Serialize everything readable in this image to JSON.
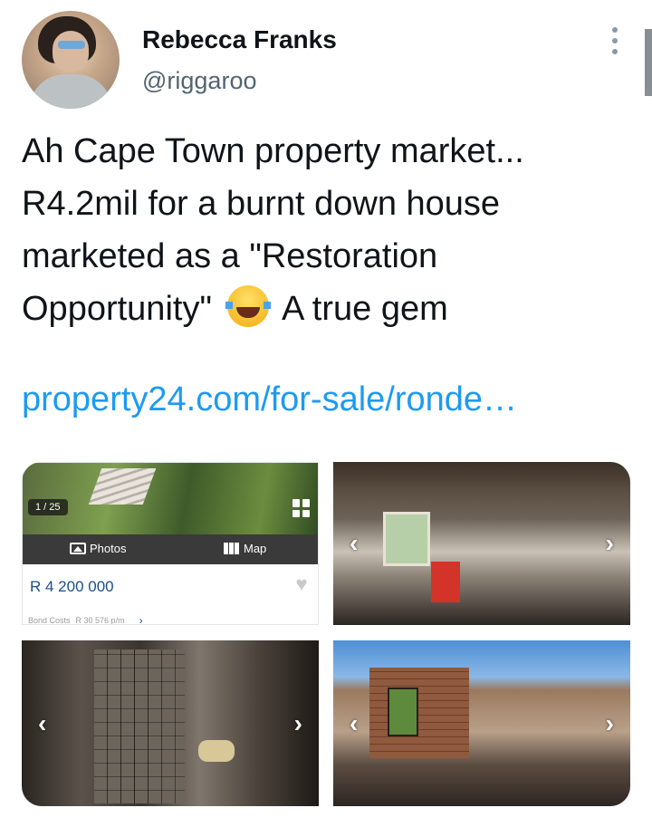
{
  "author": {
    "name": "Rebecca Franks",
    "handle": "@riggaroo"
  },
  "tweet": {
    "text_before_emoji": "Ah Cape Town property market...\nR4.2mil for a burnt down house\nmarketed as a \"Restoration\nOpportunity\"",
    "emoji": "face-with-tears-of-joy",
    "text_after_emoji": "A true gem",
    "link": "property24.com/for-sale/ronde…"
  },
  "media": {
    "listing": {
      "photo_counter": "1 / 25",
      "photos_label": "Photos",
      "map_label": "Map",
      "price": "R 4 200 000",
      "bond_costs_label": "Bond Costs",
      "bond_costs_value": "R 30 576 p/m"
    },
    "images": [
      "kitchen",
      "bathroom",
      "burnt-room"
    ]
  },
  "colors": {
    "link": "#1d9bf0",
    "handle": "#536471",
    "price": "#1a4f8b"
  }
}
